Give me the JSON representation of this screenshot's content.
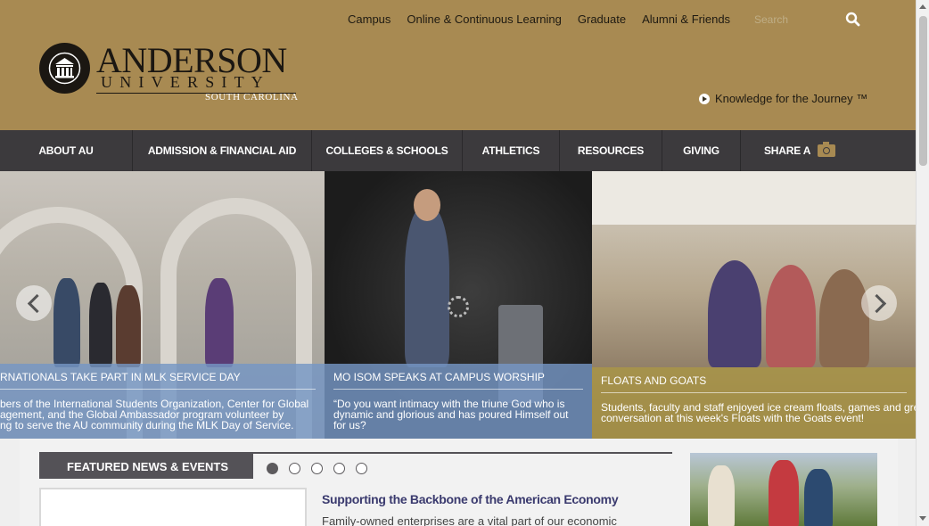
{
  "header": {
    "top_links": [
      "Campus",
      "Online & Continuous Learning",
      "Graduate",
      "Alumni & Friends"
    ],
    "search_placeholder": "Search",
    "search_icon": "search-icon",
    "logo": {
      "name": "ANDERSON",
      "university": "UNIVERSITY",
      "state": "SOUTH CAROLINA"
    },
    "tagline": "Knowledge for the Journey ™",
    "brand_color": "#a88a52"
  },
  "nav": {
    "items": [
      {
        "label": "ABOUT AU"
      },
      {
        "label": "ADMISSION & FINANCIAL AID"
      },
      {
        "label": "COLLEGES & SCHOOLS"
      },
      {
        "label": "ATHLETICS"
      },
      {
        "label": "RESOURCES"
      },
      {
        "label": "GIVING"
      },
      {
        "label": "SHARE A",
        "icon": "camera-icon"
      }
    ],
    "bg_color": "#3c3a3d"
  },
  "slider": {
    "slides": [
      {
        "title": "RNATIONALS TAKE PART IN MLK SERVICE DAY",
        "text_lines": [
          "bers of the International Students Organization, Center for Global",
          "agement, and the Global Ambassador program volunteer by",
          "ng to serve the AU community during the MLK Day of Service."
        ]
      },
      {
        "title": "MO ISOM SPEAKS AT CAMPUS WORSHIP",
        "text_lines": [
          " “Do you want intimacy with the triune God who is",
          "dynamic and glorious and has poured Himself out",
          "for us?"
        ]
      },
      {
        "title": "FLOATS AND GOATS",
        "text_lines": [
          "Students, faculty and staff enjoyed ice cream floats, games and gre",
          "conversation at this week's Floats with the Goats event!"
        ]
      }
    ]
  },
  "featured": {
    "title": "FEATURED NEWS & EVENTS",
    "dots": [
      true,
      false,
      false,
      false,
      false
    ],
    "headline": "Supporting the Backbone of the American Economy",
    "text": "Family-owned enterprises are a vital part of our economic"
  }
}
